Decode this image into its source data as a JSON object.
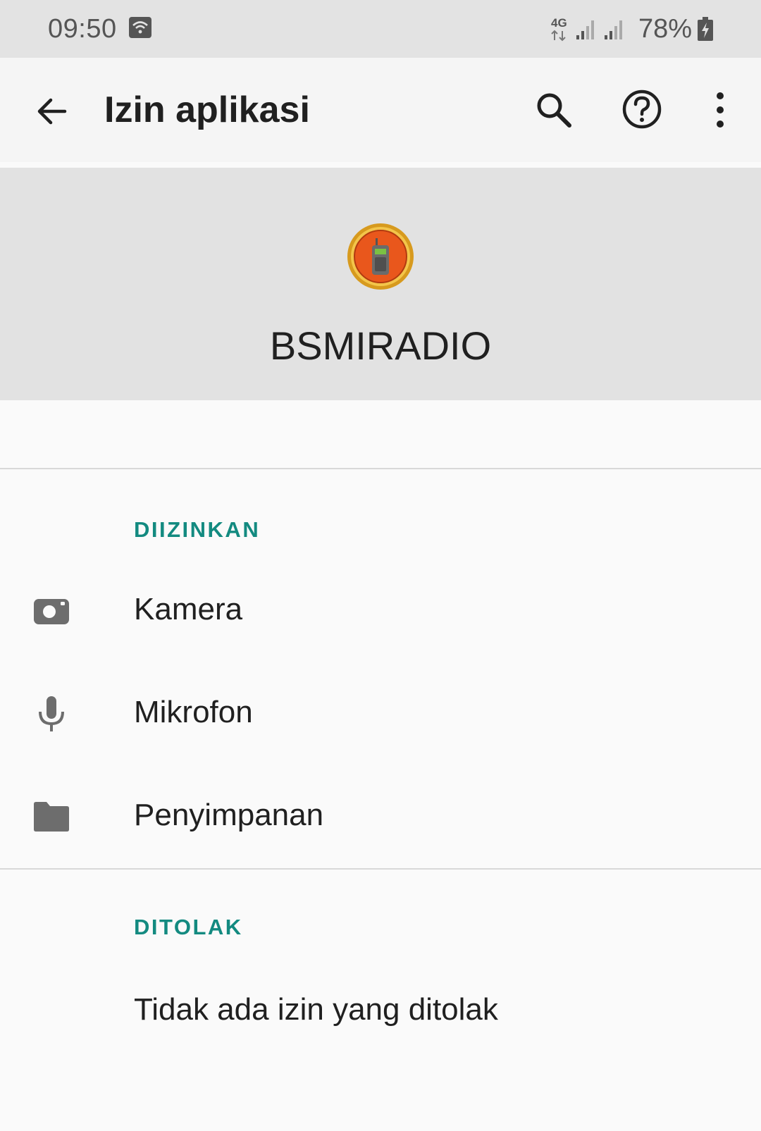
{
  "status_bar": {
    "time": "09:50",
    "network_type": "4G",
    "battery_percent": "78%",
    "icons": [
      "wifi-icon",
      "network-4g-icon",
      "signal-icon",
      "signal-icon",
      "battery-charging-icon"
    ]
  },
  "app_bar": {
    "title": "Izin aplikasi",
    "icons": [
      "back-arrow-icon",
      "search-icon",
      "help-icon",
      "more-vert-icon"
    ]
  },
  "app_header": {
    "app_name": "BSMIRADIO",
    "icon": "walkie-talkie-app-icon"
  },
  "sections": {
    "allowed": {
      "label": "DIIZINKAN",
      "items": [
        {
          "label": "Kamera",
          "icon": "camera-icon"
        },
        {
          "label": "Mikrofon",
          "icon": "microphone-icon"
        },
        {
          "label": "Penyimpanan",
          "icon": "folder-icon"
        }
      ]
    },
    "denied": {
      "label": "DITOLAK",
      "empty_text": "Tidak ada izin yang ditolak"
    }
  },
  "colors": {
    "accent": "#138a80",
    "icon_gray": "#6d6d6d",
    "header_bg": "#e2e2e2",
    "status_bar_bg": "#e3e3e3"
  }
}
